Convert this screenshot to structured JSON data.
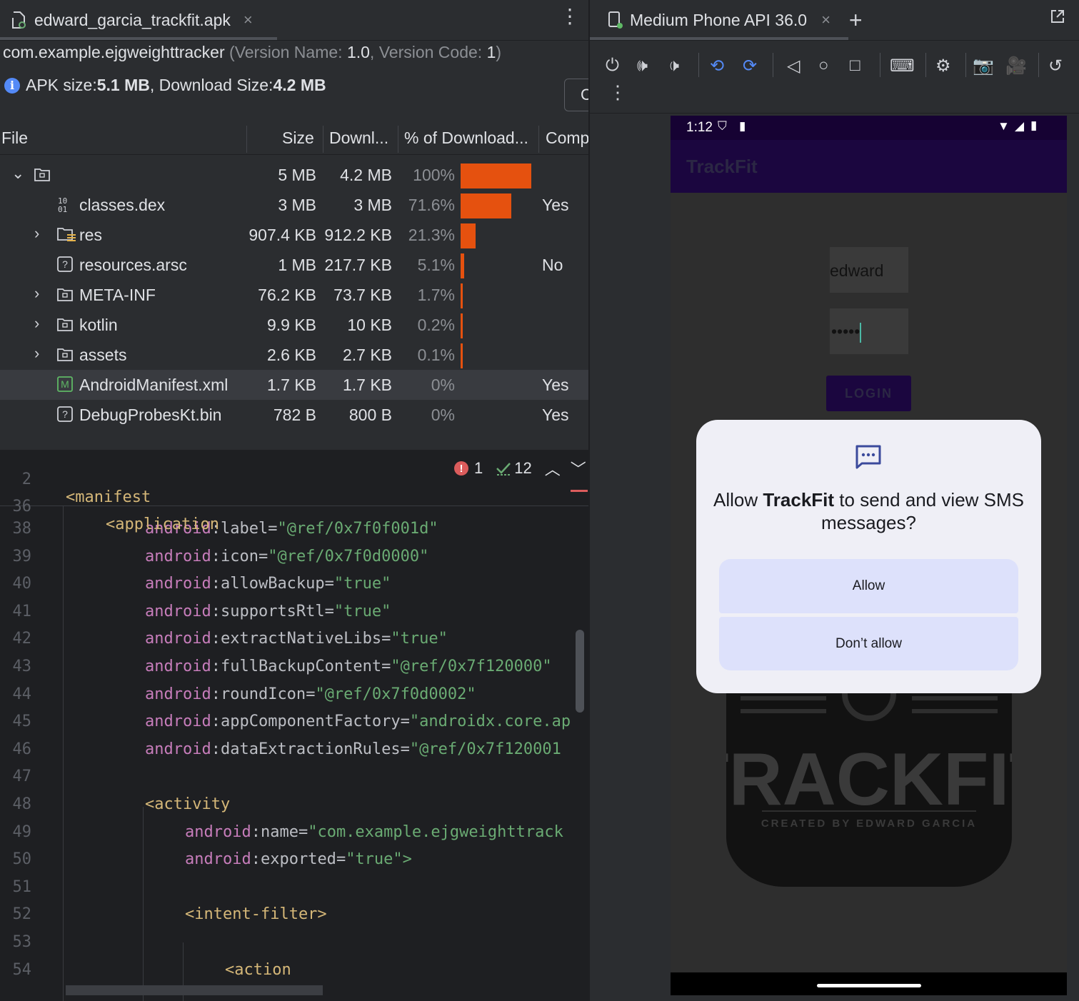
{
  "left_tab": {
    "title": "edward_garcia_trackfit.apk",
    "close": "×"
  },
  "right_tab": {
    "title": "Medium Phone API 36.0",
    "close": "×",
    "add": "+"
  },
  "apk": {
    "package": "com.example.ejgweighttracker",
    "version_prefix": "(Version Name: ",
    "version_name": "1.0",
    "version_mid": ", Version Code: ",
    "version_code": "1",
    "version_suffix": ")",
    "size_label": "APK size: ",
    "size_value": "5.1 MB",
    "download_label": ", Download Size: ",
    "download_value": "4.2 MB",
    "compare_button": "C"
  },
  "table": {
    "headers": [
      "File",
      "Size",
      "Downl...",
      "% of Download...",
      "Comp"
    ],
    "rows": [
      {
        "name": "",
        "size": "5 MB",
        "download": "4.2 MB",
        "pct": "100%",
        "pct_value": 100,
        "compressed": "",
        "icon": "folder-icon",
        "expand": "expanded",
        "indent": 0
      },
      {
        "name": "classes.dex",
        "size": "3 MB",
        "download": "3 MB",
        "pct": "71.6%",
        "pct_value": 71.6,
        "compressed": "Yes",
        "icon": "dex-icon",
        "expand": "none",
        "indent": 1
      },
      {
        "name": "res",
        "size": "907.4 KB",
        "download": "912.2 KB",
        "pct": "21.3%",
        "pct_value": 21.3,
        "compressed": "",
        "icon": "res-folder-icon",
        "expand": "collapsed",
        "indent": 1
      },
      {
        "name": "resources.arsc",
        "size": "1 MB",
        "download": "217.7 KB",
        "pct": "5.1%",
        "pct_value": 5.1,
        "compressed": "No",
        "icon": "unknown-file-icon",
        "expand": "none",
        "indent": 1
      },
      {
        "name": "META-INF",
        "size": "76.2 KB",
        "download": "73.7 KB",
        "pct": "1.7%",
        "pct_value": 1.7,
        "compressed": "",
        "icon": "folder-icon",
        "expand": "collapsed",
        "indent": 1
      },
      {
        "name": "kotlin",
        "size": "9.9 KB",
        "download": "10 KB",
        "pct": "0.2%",
        "pct_value": 0.2,
        "compressed": "",
        "icon": "folder-icon",
        "expand": "collapsed",
        "indent": 1
      },
      {
        "name": "assets",
        "size": "2.6 KB",
        "download": "2.7 KB",
        "pct": "0.1%",
        "pct_value": 0.1,
        "compressed": "",
        "icon": "folder-icon",
        "expand": "collapsed",
        "indent": 1
      },
      {
        "name": "AndroidManifest.xml",
        "size": "1.7 KB",
        "download": "1.7 KB",
        "pct": "0%",
        "pct_value": 0,
        "compressed": "Yes",
        "icon": "manifest-icon",
        "expand": "none",
        "indent": 1,
        "selected": true
      },
      {
        "name": "DebugProbesKt.bin",
        "size": "782 B",
        "download": "800 B",
        "pct": "0%",
        "pct_value": 0,
        "compressed": "Yes",
        "icon": "unknown-file-icon",
        "expand": "none",
        "indent": 1
      }
    ]
  },
  "editor": {
    "errors": "1",
    "warnings": "12",
    "sticky": [
      {
        "num": "2",
        "text": "<manifest"
      },
      {
        "num": "36",
        "text": "<application"
      }
    ],
    "lines": [
      {
        "num": "38",
        "ns": "android",
        "attr": "label",
        "val": "\"@ref/0x7f0f001d\""
      },
      {
        "num": "39",
        "ns": "android",
        "attr": "icon",
        "val": "\"@ref/0x7f0d0000\""
      },
      {
        "num": "40",
        "ns": "android",
        "attr": "allowBackup",
        "val": "\"true\""
      },
      {
        "num": "41",
        "ns": "android",
        "attr": "supportsRtl",
        "val": "\"true\""
      },
      {
        "num": "42",
        "ns": "android",
        "attr": "extractNativeLibs",
        "val": "\"true\""
      },
      {
        "num": "43",
        "ns": "android",
        "attr": "fullBackupContent",
        "val": "\"@ref/0x7f120000\""
      },
      {
        "num": "44",
        "ns": "android",
        "attr": "roundIcon",
        "val": "\"@ref/0x7f0d0002\""
      },
      {
        "num": "45",
        "ns": "android",
        "attr": "appComponentFactory",
        "val": "\"androidx.core.ap"
      },
      {
        "num": "46",
        "ns": "android",
        "attr": "dataExtractionRules",
        "val": "\"@ref/0x7f120001"
      },
      {
        "num": "47",
        "tag": ""
      },
      {
        "num": "48",
        "tag": "<activity"
      },
      {
        "num": "49",
        "ns": "android",
        "attr": "name",
        "val": "\"com.example.ejgweighttrack"
      },
      {
        "num": "50",
        "ns": "android",
        "attr": "exported",
        "val": "\"true\">"
      },
      {
        "num": "51",
        "tag": ""
      },
      {
        "num": "52",
        "tag": "<intent-filter>"
      },
      {
        "num": "53",
        "tag": ""
      },
      {
        "num": "54",
        "tag": "<action"
      }
    ]
  },
  "emulator": {
    "status_time": "1:12",
    "app_title": "TrackFit",
    "username": "edward",
    "password": "•••••",
    "login": "LOGIN",
    "logo_text": "TRACKFIT",
    "logo_sub": "CREATED BY EDWARD GARCIA",
    "dialog": {
      "prefix": "Allow ",
      "app": "TrackFit",
      "suffix": " to send and view SMS messages?",
      "allow": "Allow",
      "deny": "Don’t allow"
    }
  },
  "colors": {
    "bar": "#e5510f",
    "app_bar": "#1b063f",
    "dialog_bg": "#efeff6",
    "dialog_button": "#dde1fb"
  }
}
